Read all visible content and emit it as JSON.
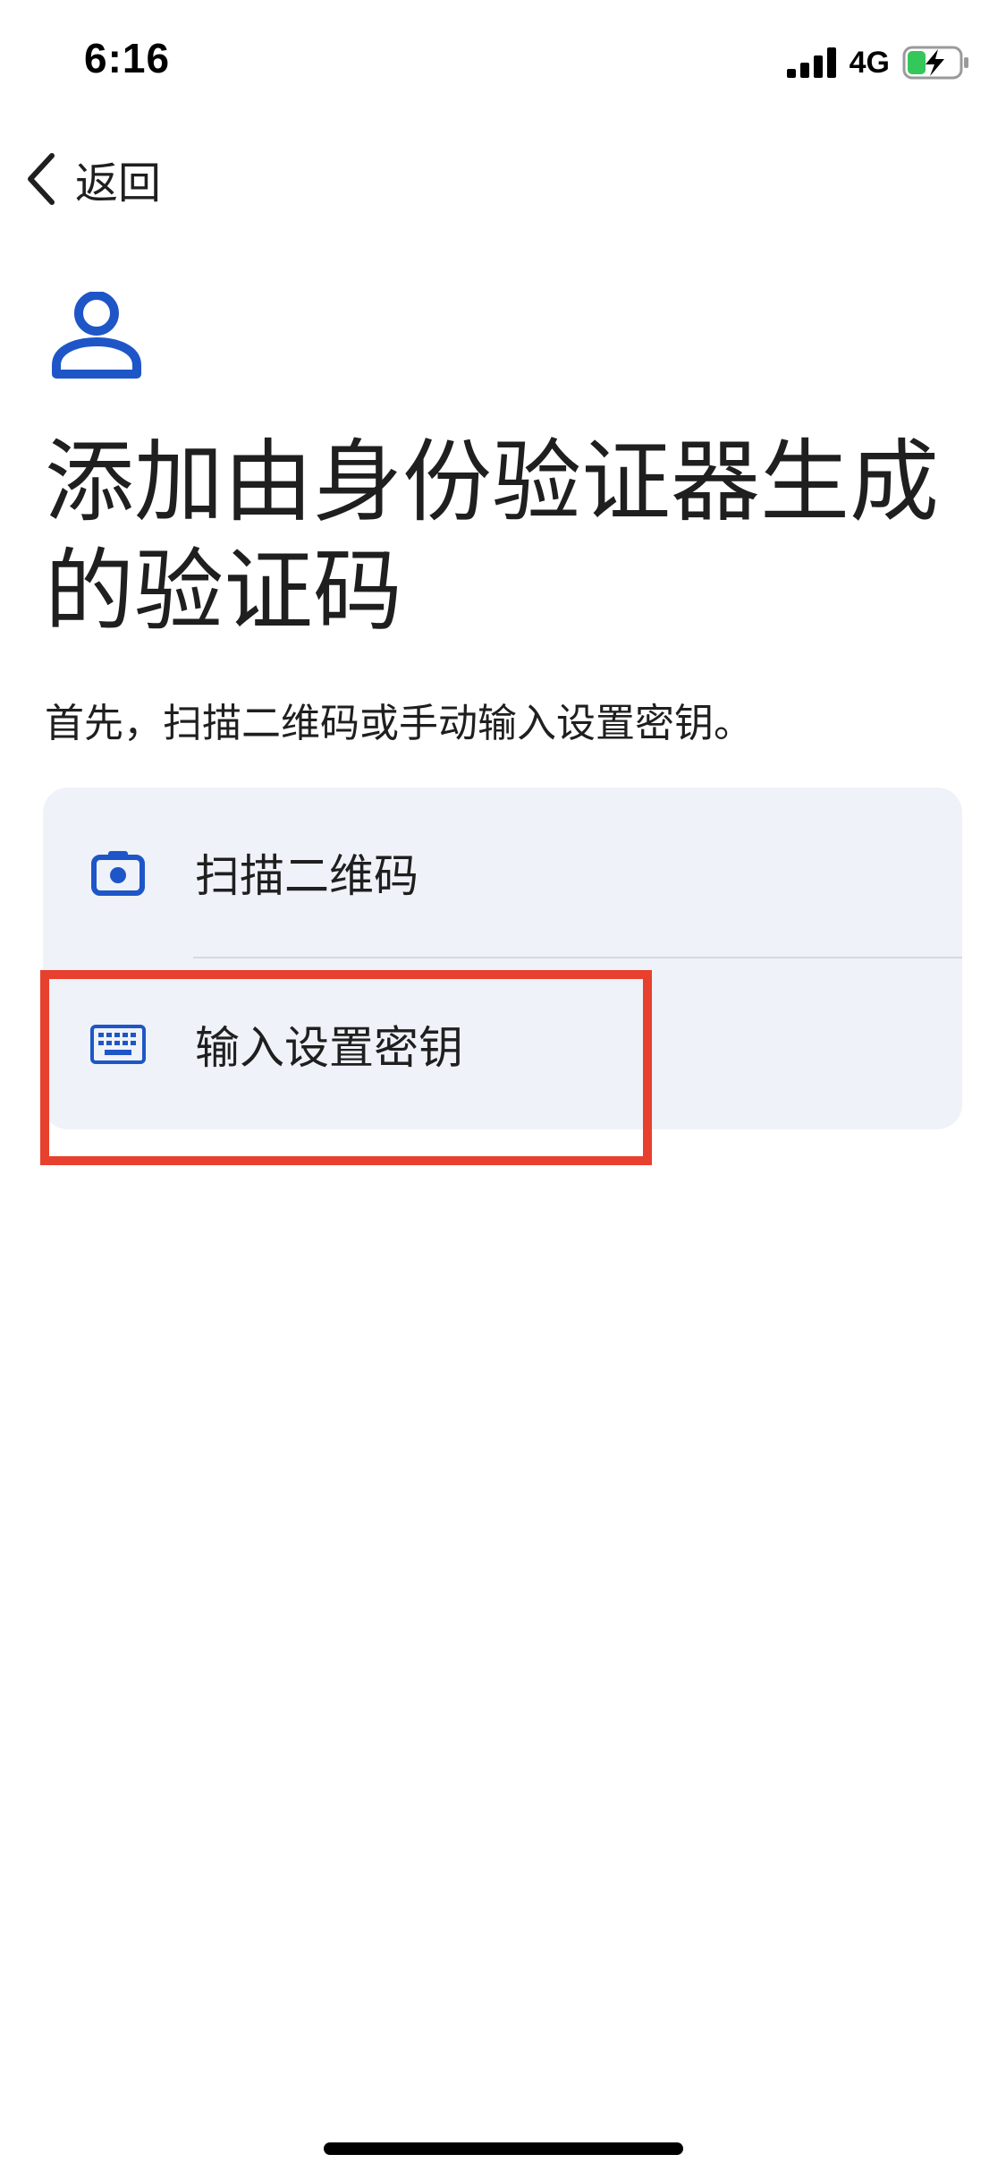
{
  "status_bar": {
    "time": "6:16",
    "network": "4G"
  },
  "nav": {
    "back_label": "返回"
  },
  "header": {
    "title": "添加由身份验证器生成的验证码",
    "subtitle": "首先，扫描二维码或手动输入设置密钥。"
  },
  "options": [
    {
      "label": "扫描二维码",
      "icon": "camera-icon"
    },
    {
      "label": "输入设置密钥",
      "icon": "keyboard-icon"
    }
  ],
  "colors": {
    "accent": "#1e56c8",
    "card_bg": "#eff2f8",
    "highlight": "#e8402e",
    "battery_fill": "#34c759"
  }
}
